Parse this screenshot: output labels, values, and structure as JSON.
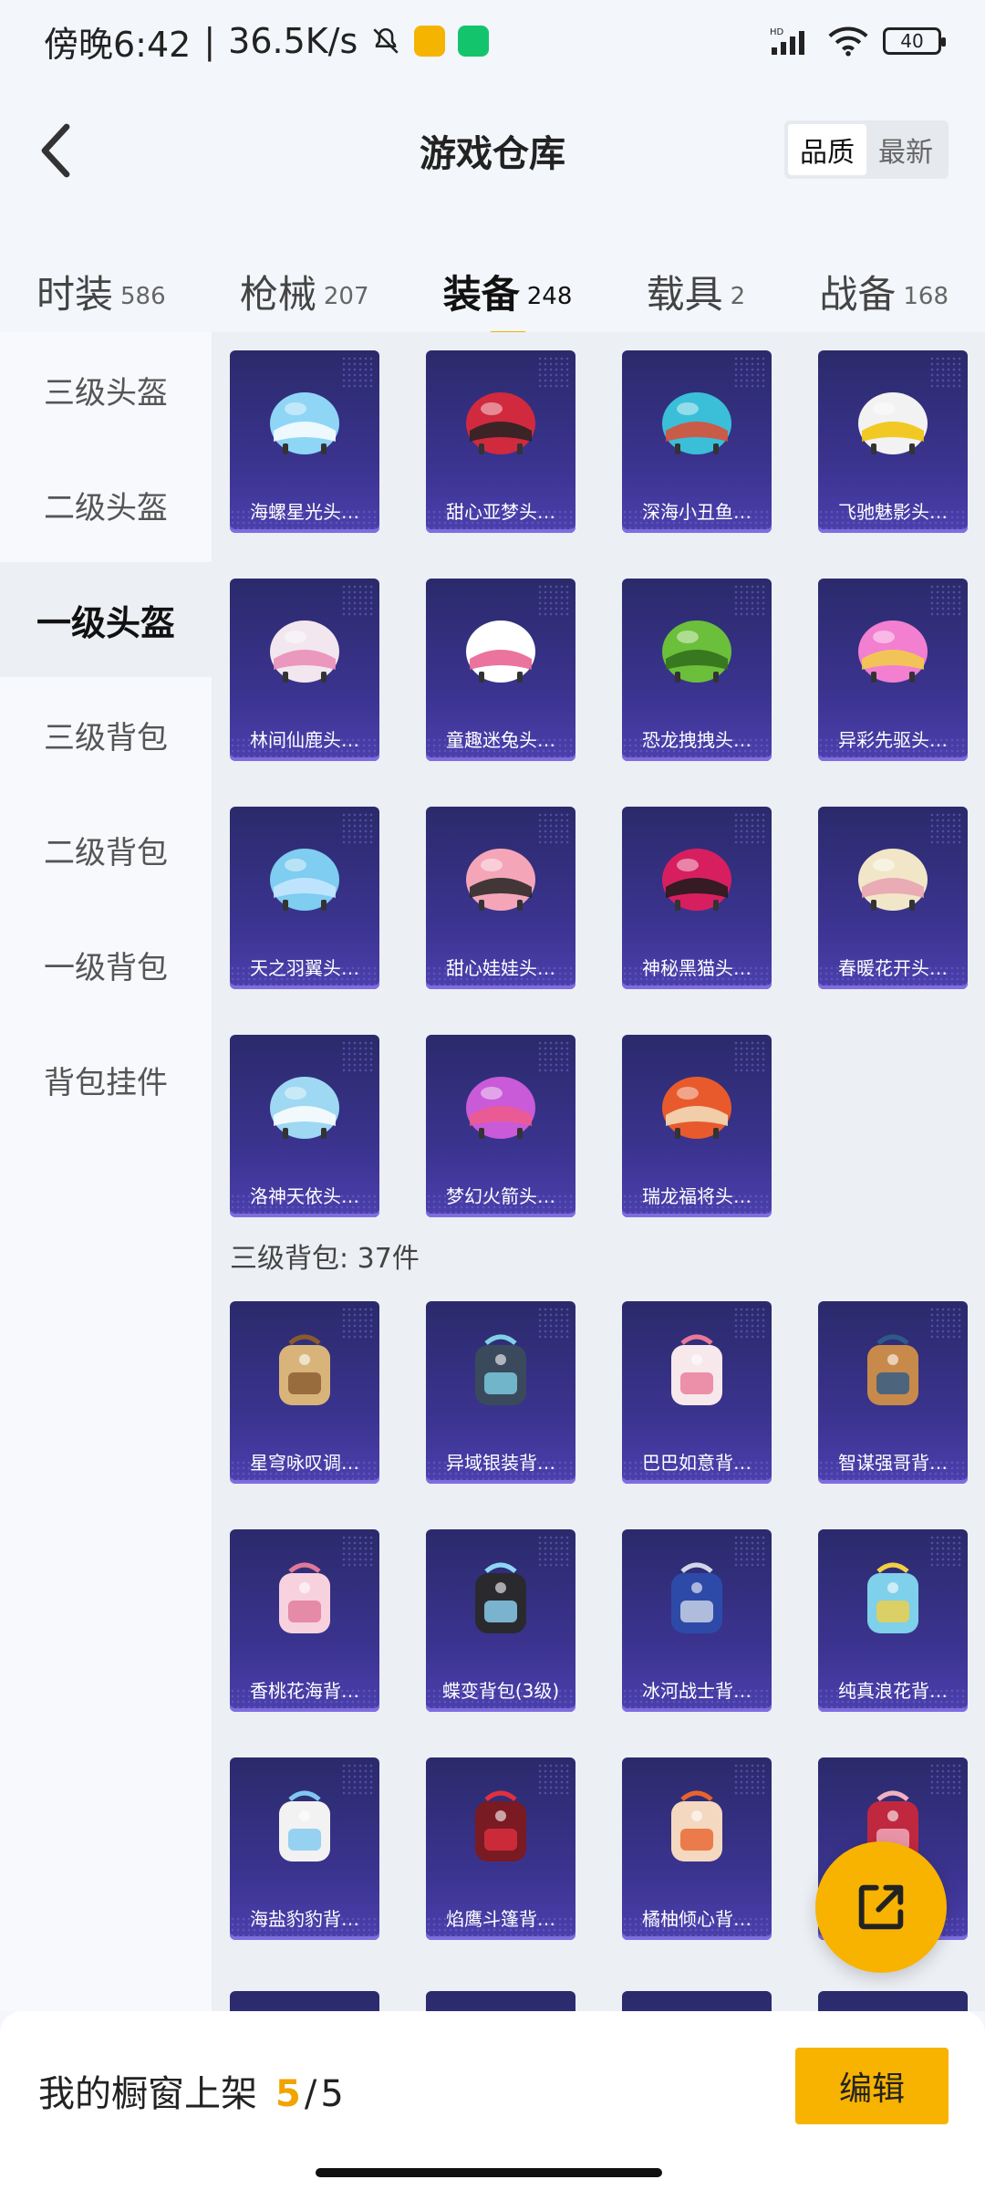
{
  "status_bar": {
    "time": "傍晚6:42",
    "speed": "36.5K/s",
    "battery": "40",
    "network_label": "HD"
  },
  "header": {
    "title": "游戏仓库",
    "sort_options": [
      "品质",
      "最新"
    ],
    "sort_active": "品质"
  },
  "tabs": [
    {
      "label": "时装",
      "count": "586"
    },
    {
      "label": "枪械",
      "count": "207"
    },
    {
      "label": "装备",
      "count": "248",
      "active": true
    },
    {
      "label": "载具",
      "count": "2"
    },
    {
      "label": "战备",
      "count": "168"
    }
  ],
  "sidebar": {
    "items": [
      "三级头盔",
      "二级头盔",
      "一级头盔",
      "三级背包",
      "二级背包",
      "一级背包",
      "背包挂件"
    ],
    "active": "一级头盔"
  },
  "helmets": [
    {
      "name": "海螺星光头…",
      "color": "#8fd6f6",
      "accent": "#ffffff"
    },
    {
      "name": "甜心亚梦头…",
      "color": "#d1293e",
      "accent": "#222222"
    },
    {
      "name": "深海小丑鱼…",
      "color": "#3bbfd9",
      "accent": "#e24a2e"
    },
    {
      "name": "飞驰魅影头…",
      "color": "#f2f2f2",
      "accent": "#f2c200"
    },
    {
      "name": "林间仙鹿头…",
      "color": "#f3e7ef",
      "accent": "#e989b5"
    },
    {
      "name": "童趣迷兔头…",
      "color": "#ffffff",
      "accent": "#e65c8c"
    },
    {
      "name": "恐龙拽拽头…",
      "color": "#6bbf3a",
      "accent": "#2f6b1b"
    },
    {
      "name": "异彩先驱头…",
      "color": "#f27fd0",
      "accent": "#f2d043"
    },
    {
      "name": "天之羽翼头…",
      "color": "#7fcdf0",
      "accent": "#c9e8ff"
    },
    {
      "name": "甜心娃娃头…",
      "color": "#f4a6b8",
      "accent": "#222222"
    },
    {
      "name": "神秘黑猫头…",
      "color": "#d71f60",
      "accent": "#1a1a1a"
    },
    {
      "name": "春暖花开头…",
      "color": "#f1e7c8",
      "accent": "#e8a0b0"
    },
    {
      "name": "洛神天依头…",
      "color": "#9fd8f2",
      "accent": "#ffffff"
    },
    {
      "name": "梦幻火箭头…",
      "color": "#c95ad8",
      "accent": "#f05a8a"
    },
    {
      "name": "瑞龙福将头…",
      "color": "#e85a2c",
      "accent": "#f2e2c0"
    }
  ],
  "backpack_section": {
    "title": "三级背包: 37件"
  },
  "backpacks": [
    {
      "name": "星穹咏叹调…",
      "color": "#d8b47a",
      "accent": "#8a5a2e"
    },
    {
      "name": "异域银装背…",
      "color": "#3a4a5c",
      "accent": "#7fd0e6"
    },
    {
      "name": "巴巴如意背…",
      "color": "#f7e8ec",
      "accent": "#e87898"
    },
    {
      "name": "智谋强哥背…",
      "color": "#c88a4a",
      "accent": "#2e5a8a"
    },
    {
      "name": "香桃花海背…",
      "color": "#f7d2de",
      "accent": "#e07898"
    },
    {
      "name": "蝶变背包(3级)",
      "color": "#2a2a2e",
      "accent": "#8fd6f6"
    },
    {
      "name": "冰河战士背…",
      "color": "#2e4aa8",
      "accent": "#d0d8e8"
    },
    {
      "name": "纯真浪花背…",
      "color": "#7fd0ea",
      "accent": "#f2d043"
    },
    {
      "name": "海盐豹豹背…",
      "color": "#f2f2f2",
      "accent": "#7fc8f0"
    },
    {
      "name": "焰鹰斗篷背…",
      "color": "#7a1a22",
      "accent": "#e03040"
    },
    {
      "name": "橘柚倾心背…",
      "color": "#f4d8c0",
      "accent": "#e8642c"
    },
    {
      "name": "",
      "color": "#c02840",
      "accent": "#f2b0c0"
    }
  ],
  "bottom_bar": {
    "shelf_label": "我的橱窗上架",
    "shelf_current": "5",
    "shelf_separator": "/",
    "shelf_total": "5",
    "edit_label": "编辑"
  },
  "colors": {
    "accent": "#f7b300",
    "card_bg": "#3b3491"
  }
}
